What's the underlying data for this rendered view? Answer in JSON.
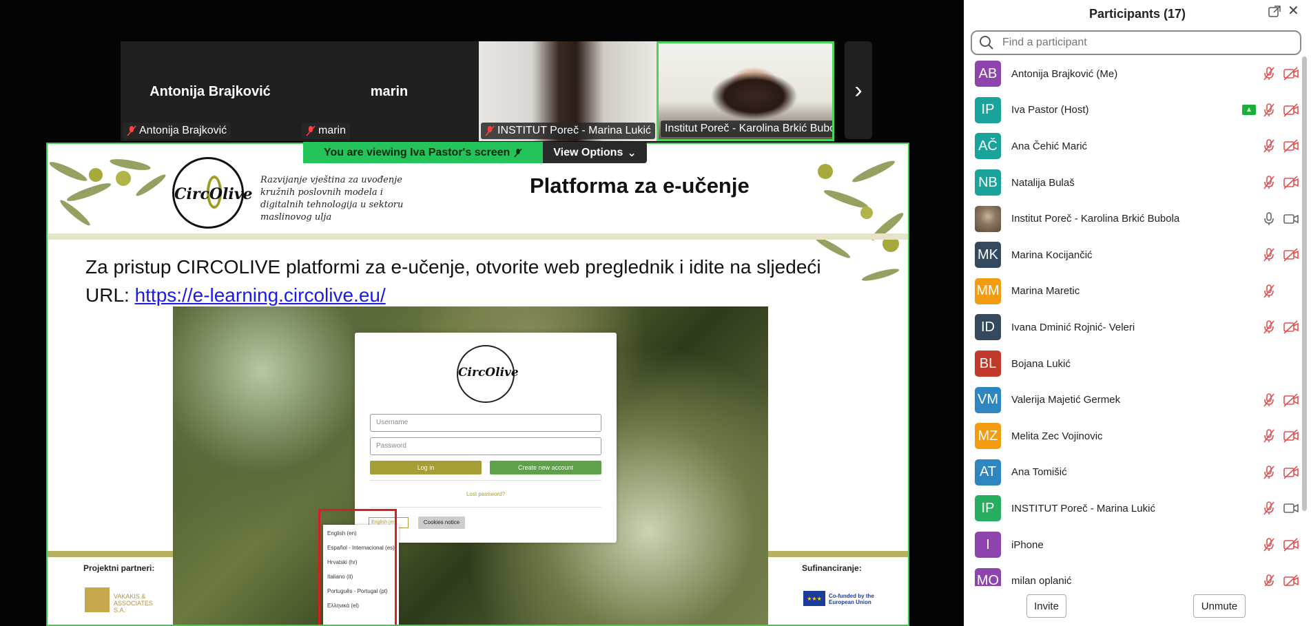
{
  "tiles": [
    {
      "name_big": "Antonija Brajković",
      "label": "Antonija Brajković"
    },
    {
      "name_big": "marin",
      "label": "marin"
    },
    {
      "label": "INSTITUT Poreč - Marina Lukić"
    },
    {
      "label": "Institut Poreč - Karolina Brkić Bubola"
    }
  ],
  "share_banner": {
    "viewing": "You are viewing  Iva Pastor's screen",
    "view_options": "View Options"
  },
  "slide": {
    "logo_text": "CircOlive",
    "subtitle": "Razvijanje vještina za uvođenje kružnih poslovnih modela i digitalnih tehnologija u sektoru maslinovog ulja",
    "title": "Platforma za e-učenje",
    "body": "Za pristup CIRCOLIVE platformi za e-učenje, otvorite web preglednik i idite na sljedeći URL: ",
    "link": "https://e-learning.circolive.eu/",
    "partners_label": "Projektni partneri:",
    "partner_name": "VAKAKIS & ASSOCIATES S.A.",
    "cofund_label": "Sufinanciranje:",
    "eu_text": "Co-funded by the European Union",
    "login": {
      "logo_text": "CircOlive",
      "username_placeholder": "Username",
      "password_placeholder": "Password",
      "login_button": "Log in",
      "create_button": "Create new account",
      "lost_password": "Lost password?",
      "lang_select": "English (en)",
      "cookies": "Cookies notice",
      "languages": [
        "English (en)",
        "Español - Internacional (es)",
        "Hrvatski (hr)",
        "Italiano (it)",
        "Português - Portugal (pt)",
        "Ελληνικά (el)"
      ]
    }
  },
  "panel": {
    "title": "Participants (17)",
    "search_placeholder": "Find a participant",
    "invite": "Invite",
    "unmute": "Unmute",
    "participants": [
      {
        "initials": "AB",
        "color": "#8e44ad",
        "name": "Antonija Brajković (Me)",
        "mic": "muted",
        "video": "off"
      },
      {
        "initials": "IP",
        "color": "#1aa39a",
        "name": "Iva Pastor (Host)",
        "mic": "muted",
        "video": "off",
        "sharing": true
      },
      {
        "initials": "AČ",
        "color": "#1aa39a",
        "name": "Ana Čehić Marić",
        "mic": "muted",
        "video": "off"
      },
      {
        "initials": "NB",
        "color": "#1aa39a",
        "name": "Natalija Bulaš",
        "mic": "muted",
        "video": "off"
      },
      {
        "initials": "",
        "color": "#7a6a55",
        "name": "Institut Poreč - Karolina Brkić Bubola",
        "mic": "on",
        "video": "on",
        "photo": true
      },
      {
        "initials": "MK",
        "color": "#34495e",
        "name": "Marina Kocijančić",
        "mic": "muted",
        "video": "off"
      },
      {
        "initials": "MM",
        "color": "#f39c12",
        "name": "Marina Maretic",
        "mic": "muted",
        "video": "none"
      },
      {
        "initials": "ID",
        "color": "#34495e",
        "name": "Ivana Dminić Rojnić- Veleri",
        "mic": "muted",
        "video": "off"
      },
      {
        "initials": "BL",
        "color": "#c0392b",
        "name": "Bojana Lukić",
        "mic": "none",
        "video": "none"
      },
      {
        "initials": "VM",
        "color": "#2e86c1",
        "name": "Valerija Majetić Germek",
        "mic": "muted",
        "video": "off"
      },
      {
        "initials": "MZ",
        "color": "#f39c12",
        "name": "Melita Zec Vojinovic",
        "mic": "muted",
        "video": "off"
      },
      {
        "initials": "AT",
        "color": "#2e86c1",
        "name": "Ana Tomišić",
        "mic": "muted",
        "video": "off"
      },
      {
        "initials": "IP",
        "color": "#27ae60",
        "name": "INSTITUT Poreč - Marina Lukić",
        "mic": "muted",
        "video": "on"
      },
      {
        "initials": "I",
        "color": "#8e44ad",
        "name": "iPhone",
        "mic": "muted",
        "video": "off"
      },
      {
        "initials": "MO",
        "color": "#8e44ad",
        "name": "milan oplanić",
        "mic": "muted",
        "video": "off"
      }
    ]
  }
}
